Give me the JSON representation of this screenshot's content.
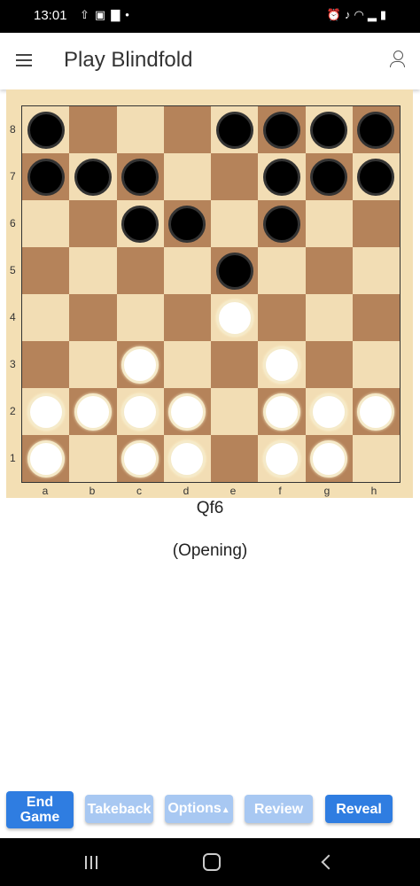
{
  "status_bar": {
    "time": "13:01",
    "left_icons": [
      "upload-icon",
      "image-icon",
      "shopping-bag-icon",
      "dot-icon"
    ],
    "right_icons": [
      "alarm-icon",
      "mute-icon",
      "wifi-icon",
      "signal-icon",
      "battery-icon"
    ]
  },
  "app_bar": {
    "title": "Play Blindfold"
  },
  "board": {
    "light_color": "#f2ddb4",
    "dark_color": "#b5835a",
    "rows": [
      [
        "b",
        "",
        "",
        "",
        "b",
        "b",
        "b",
        "b"
      ],
      [
        "b",
        "b",
        "b",
        "",
        "",
        "b",
        "b",
        "b"
      ],
      [
        "",
        "",
        "b",
        "b",
        "",
        "b",
        "",
        ""
      ],
      [
        "",
        "",
        "",
        "",
        "b",
        "",
        "",
        ""
      ],
      [
        "",
        "",
        "",
        "",
        "w",
        "",
        "",
        ""
      ],
      [
        "",
        "",
        "w",
        "",
        "",
        "w",
        "",
        ""
      ],
      [
        "w",
        "w",
        "w",
        "w",
        "",
        "w",
        "w",
        "w"
      ],
      [
        "w",
        "",
        "w",
        "w",
        "",
        "w",
        "w",
        ""
      ]
    ],
    "ranks": [
      "8",
      "7",
      "6",
      "5",
      "4",
      "3",
      "2",
      "1"
    ],
    "files": [
      "a",
      "b",
      "c",
      "d",
      "e",
      "f",
      "g",
      "h"
    ]
  },
  "game": {
    "last_move": "Qf6",
    "phase": "(Opening)"
  },
  "toolbar": {
    "end_game_line1": "End",
    "end_game_line2": "Game",
    "takeback_label": "Takeback",
    "options_label": "Options",
    "options_arrow": "▲",
    "review_label": "Review",
    "reveal_label": "Reveal"
  },
  "colors": {
    "accent": "#2f7de1",
    "accent_disabled": "#a8c8f2"
  }
}
